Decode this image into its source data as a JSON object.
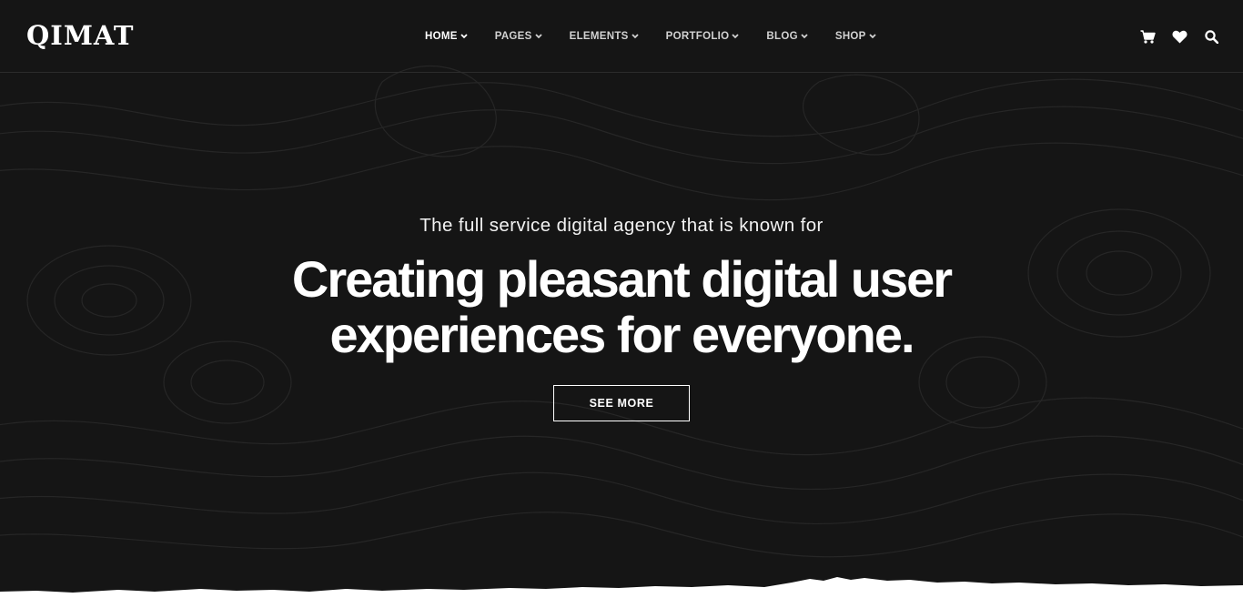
{
  "brand": {
    "logo_text": "QIMAT"
  },
  "nav": {
    "items": [
      {
        "label": "HOME",
        "active": true
      },
      {
        "label": "PAGES",
        "active": false
      },
      {
        "label": "ELEMENTS",
        "active": false
      },
      {
        "label": "PORTFOLIO",
        "active": false
      },
      {
        "label": "BLOG",
        "active": false
      },
      {
        "label": "SHOP",
        "active": false
      }
    ]
  },
  "header_icons": [
    "cart-icon",
    "heart-icon",
    "search-icon"
  ],
  "hero": {
    "subtitle": "The full service digital agency that is known for",
    "title_line1": "Creating pleasant digital user",
    "title_line2": "experiences for everyone.",
    "cta_label": "SEE MORE"
  },
  "colors": {
    "background": "#151515",
    "text": "#ffffff",
    "nav_text": "#d2d2d2",
    "divider": "#2b2b2b"
  }
}
